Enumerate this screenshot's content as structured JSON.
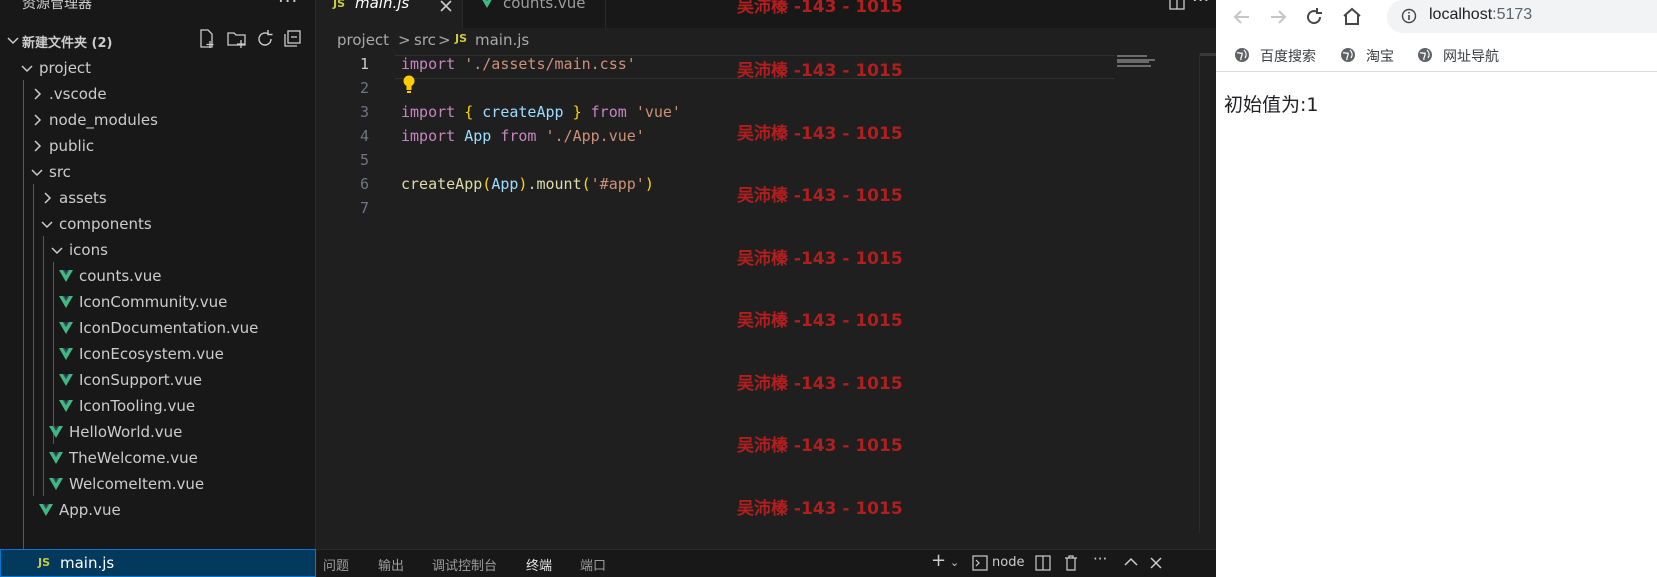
{
  "explorer": {
    "title": "资源管理器",
    "more": "···",
    "folder": "新建文件夹 (2)",
    "tree": [
      {
        "label": "project"
      },
      {
        "label": ".vscode"
      },
      {
        "label": "node_modules"
      },
      {
        "label": "public"
      },
      {
        "label": "src"
      },
      {
        "label": "assets"
      },
      {
        "label": "components"
      },
      {
        "label": "icons"
      },
      {
        "label": "counts.vue"
      },
      {
        "label": "IconCommunity.vue"
      },
      {
        "label": "IconDocumentation.vue"
      },
      {
        "label": "IconEcosystem.vue"
      },
      {
        "label": "IconSupport.vue"
      },
      {
        "label": "IconTooling.vue"
      },
      {
        "label": "HelloWorld.vue"
      },
      {
        "label": "TheWelcome.vue"
      },
      {
        "label": "WelcomeItem.vue"
      },
      {
        "label": "App.vue"
      },
      {
        "label": "main.js"
      }
    ]
  },
  "editor": {
    "tabs": [
      {
        "label": "main.js",
        "icon": "JS"
      },
      {
        "label": "counts.vue"
      }
    ],
    "breadcrumb": [
      "project",
      "src",
      "main.js"
    ],
    "crumb_icon": "JS",
    "lines": [
      "1",
      "2",
      "3",
      "4",
      "5",
      "6",
      "7"
    ],
    "code": {
      "l1_kw": "import",
      "l1_str": "'./assets/main.css'",
      "l3_kw": "import",
      "l3_ob": "{",
      "l3_var": "createApp",
      "l3_cb": "}",
      "l3_from": "from",
      "l3_str": "'vue'",
      "l4_kw": "import",
      "l4_var": "App",
      "l4_from": "from",
      "l4_str": "'./App.vue'",
      "l6_fn": "createApp",
      "l6_op": "(",
      "l6_var": "App",
      "l6_cp": ")",
      "l6_dot": ".",
      "l6_fn2": "mount",
      "l6_op2": "(",
      "l6_str": "'#app'",
      "l6_cp2": ")"
    },
    "watermark": "吴沛榛 -143 - 1015",
    "panel_tabs": [
      "问题",
      "输出",
      "调试控制台",
      "终端",
      "端口"
    ],
    "terminal_label": "node"
  },
  "browser": {
    "url_host": "localhost",
    "url_port": ":5173",
    "bookmarks": [
      "百度搜索",
      "淘宝",
      "网址导航"
    ],
    "page_text": "初始值为:1"
  },
  "colors": {
    "vue_green": "#41b883",
    "js_yellow": "#cbcb41",
    "watermark": "#b01e1e",
    "selection": "#04395e"
  }
}
